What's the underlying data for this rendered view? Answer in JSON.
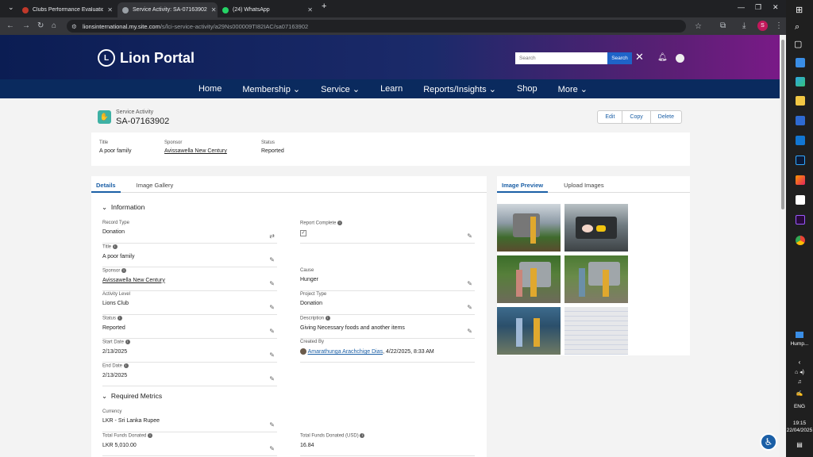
{
  "browser": {
    "tabs": [
      {
        "title": "Clubs Performance Evaluation",
        "active": false
      },
      {
        "title": "Service Activity: SA-07163902",
        "active": true
      },
      {
        "title": "(24) WhatsApp",
        "active": false
      }
    ],
    "url_host": "lionsinternational.my.site.com",
    "url_path": "/s/lci-service-activity/a29Ns000009TI82IAC/sa07163902",
    "new_tab": "+",
    "profile_initial": "S"
  },
  "header": {
    "brand": "Lion Portal",
    "search_placeholder": "Search",
    "search_button": "Search"
  },
  "nav": [
    "Home",
    "Membership ⌄",
    "Service ⌄",
    "Learn",
    "Reports/Insights ⌄",
    "Shop",
    "More ⌄"
  ],
  "record": {
    "type": "Service Activity",
    "name": "SA-07163902",
    "actions": [
      "Edit",
      "Copy",
      "Delete"
    ]
  },
  "highlights": {
    "title_label": "Title",
    "title_value": "A poor family",
    "sponsor_label": "Sponsor",
    "sponsor_value": "Avissawella New Century",
    "status_label": "Status",
    "status_value": "Reported"
  },
  "left_tabs": [
    "Details",
    "Image Gallery"
  ],
  "sections": {
    "information": "Information",
    "required_metrics": "Required Metrics"
  },
  "fields": {
    "record_type": {
      "label": "Record Type",
      "value": "Donation"
    },
    "report_complete": {
      "label": "Report Complete",
      "value": "✓"
    },
    "title": {
      "label": "Title",
      "value": "A poor family"
    },
    "sponsor": {
      "label": "Sponsor",
      "value": "Avissawella New Century"
    },
    "cause": {
      "label": "Cause",
      "value": "Hunger"
    },
    "activity_level": {
      "label": "Activity Level",
      "value": "Lions Club"
    },
    "project_type": {
      "label": "Project Type",
      "value": "Donation"
    },
    "status": {
      "label": "Status",
      "value": "Reported"
    },
    "description": {
      "label": "Description",
      "value": "Giving Necessary foods and another items"
    },
    "start_date": {
      "label": "Start Date",
      "value": "2/13/2025"
    },
    "created_by": {
      "label": "Created By",
      "value": "Amarathunga Arachchige Dias",
      "date": ", 4/22/2025, 8:33 AM"
    },
    "end_date": {
      "label": "End Date",
      "value": "2/13/2025"
    },
    "currency": {
      "label": "Currency",
      "value": "LKR - Sri Lanka Rupee"
    },
    "total_funds": {
      "label": "Total Funds Donated",
      "value": "LKR 5,010.00"
    },
    "total_funds_usd": {
      "label": "Total Funds Donated (USD)",
      "value": "16.84"
    }
  },
  "right_tabs": [
    "Image Preview",
    "Upload Images"
  ],
  "taskbar": {
    "weather_label": "Hump...",
    "lang": "ENG",
    "time": "19:15",
    "date": "22/04/2025"
  }
}
